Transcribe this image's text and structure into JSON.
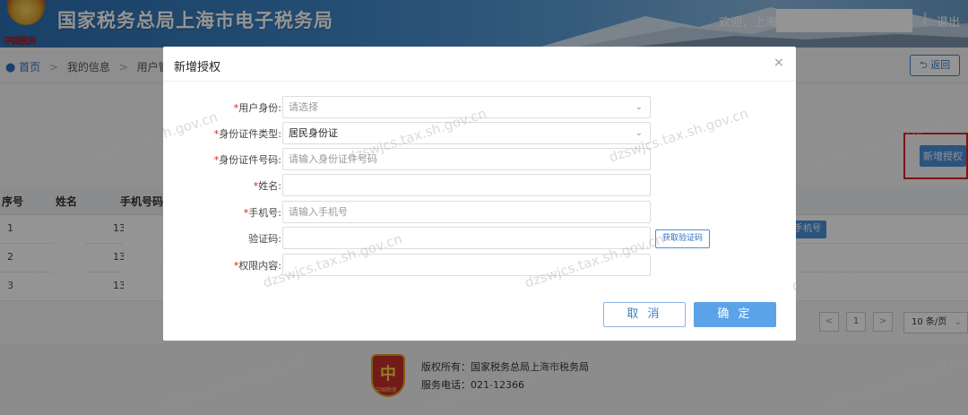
{
  "header": {
    "site_title": "国家税务总局上海市电子税务局",
    "emblem_text": "中国税务",
    "welcome": "欢迎，上海",
    "separator": "|",
    "logout": "退出"
  },
  "breadcrumb": {
    "items": [
      "首页",
      "我的信息",
      "用户管理"
    ],
    "separator": ">",
    "back_label": "返回"
  },
  "toolbar": {
    "add_auth_label": "新增授权"
  },
  "table": {
    "columns": [
      "序号",
      "姓名",
      "手机号码"
    ],
    "rows": [
      {
        "index": "1",
        "phone_prefix": "13"
      },
      {
        "index": "2",
        "phone_prefix": "13"
      },
      {
        "index": "3",
        "phone_prefix": "13"
      }
    ],
    "row_action": "手机号"
  },
  "pager": {
    "current_page": "1",
    "prev": "<",
    "next": ">",
    "page_size": "10 条/页"
  },
  "footer": {
    "copyright": "版权所有：国家税务总局上海市税务局",
    "phone": "服务电话：021-12366",
    "logo_glyph": "中",
    "logo_caption": "中国税务"
  },
  "modal": {
    "title": "新增授权",
    "close": "×",
    "fields": [
      {
        "label": "用户身份:",
        "required": true,
        "placeholder": "请选择",
        "value": "",
        "type": "select"
      },
      {
        "label": "身份证件类型:",
        "required": true,
        "placeholder": "",
        "value": "居民身份证",
        "type": "select"
      },
      {
        "label": "身份证件号码:",
        "required": true,
        "placeholder": "请输入身份证件号码",
        "value": "",
        "type": "text"
      },
      {
        "label": "姓名:",
        "required": true,
        "placeholder": "",
        "value": "",
        "type": "text"
      },
      {
        "label": "手机号:",
        "required": true,
        "placeholder": "请输入手机号",
        "value": "",
        "type": "text"
      },
      {
        "label": "验证码:",
        "required": false,
        "placeholder": "",
        "value": "",
        "type": "text"
      },
      {
        "label": "权限内容:",
        "required": true,
        "placeholder": "",
        "value": "",
        "type": "text"
      }
    ],
    "get_code_label": "获取验证码",
    "cancel_label": "取 消",
    "confirm_label": "确 定"
  },
  "watermark": "dzswjcs.tax.sh.gov.cn",
  "colors": {
    "primary": "#4a90d9",
    "required": "#e02020",
    "highlight_border": "#e02020"
  }
}
